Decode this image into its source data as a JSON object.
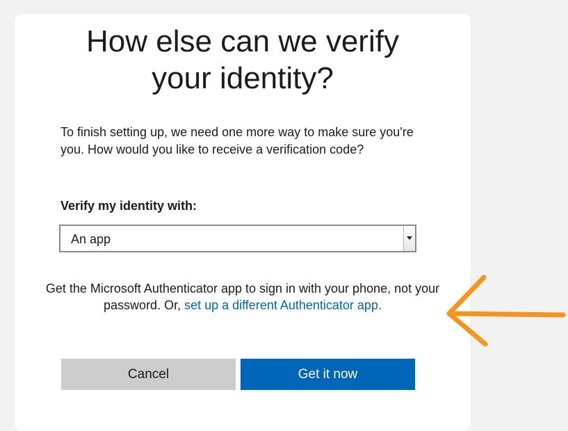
{
  "dialog": {
    "title_line1": "How else can we verify",
    "title_line2": "your identity?",
    "intro": "To finish setting up, we need one more way to make sure you're you. How would you like to receive a verification code?",
    "field_label": "Verify my identity with:",
    "select": {
      "selected_value": "An app"
    },
    "note_text": "Get the Microsoft Authenticator app to sign in with your phone, not your password. Or, ",
    "note_link": "set up a different Authenticator app.",
    "buttons": {
      "cancel_label": "Cancel",
      "primary_label": "Get it now"
    }
  },
  "annotation": {
    "arrow_color": "#f7941d",
    "arrow_icon": "left-arrow-icon"
  },
  "colors": {
    "accent": "#0067b8",
    "cancel_bg": "#cccccc",
    "page_bg": "#f2f2f2"
  }
}
